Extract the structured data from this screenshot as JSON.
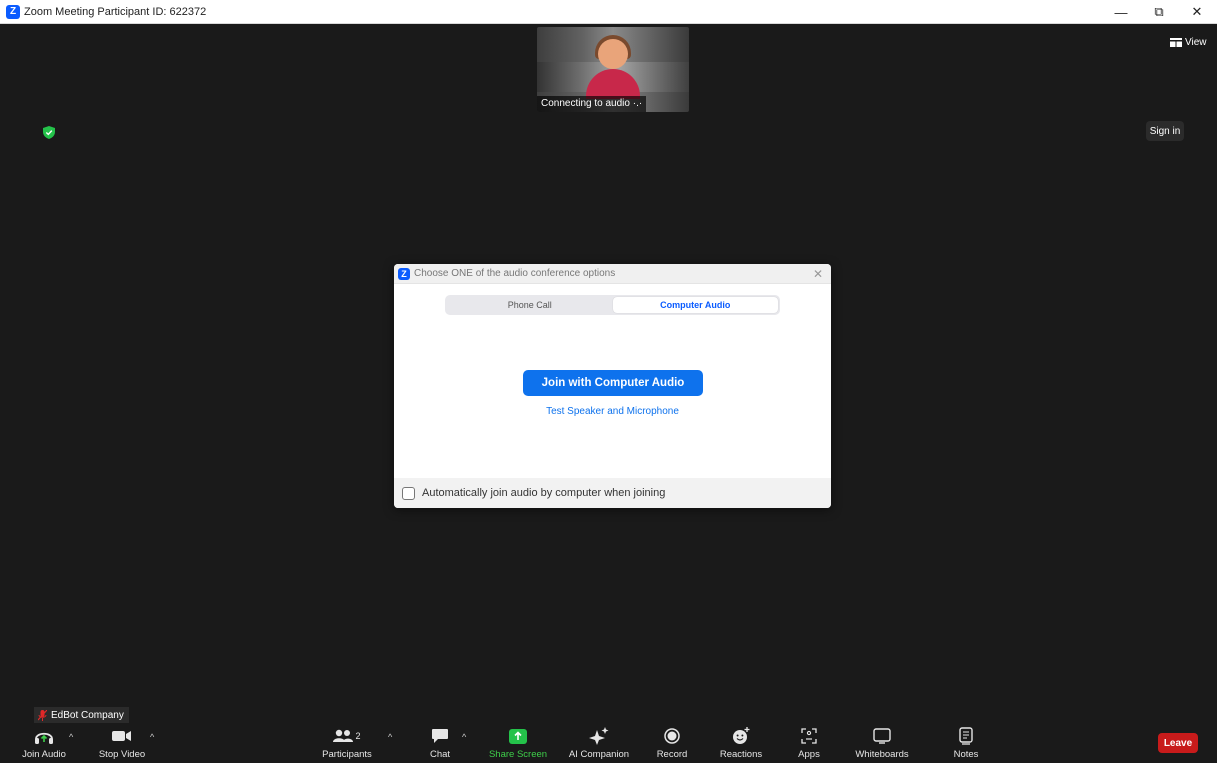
{
  "window": {
    "title": "Zoom Meeting Participant ID: 622372",
    "minimize_glyph": "—",
    "restore_glyph": "⧉",
    "close_glyph": "✕"
  },
  "stage": {
    "video_status": "Connecting to audio ·.·",
    "view_label": "View",
    "sign_in_label": "Sign in",
    "security_color": "#24c24a"
  },
  "dialog": {
    "title": "Choose ONE of the audio conference options",
    "tabs": [
      {
        "label": "Phone Call",
        "active": false
      },
      {
        "label": "Computer Audio",
        "active": true
      }
    ],
    "join_button": "Join with Computer Audio",
    "test_link": "Test Speaker and Microphone",
    "auto_join_label": "Automatically join audio by computer when joining",
    "auto_join_checked": false,
    "accent_color": "#0e72ed"
  },
  "name_tag": {
    "name": "EdBot Company",
    "muted_icon": "mic-muted-icon"
  },
  "toolbar": {
    "join_audio": "Join Audio",
    "stop_video": "Stop Video",
    "participants": "Participants",
    "participants_count": "2",
    "chat": "Chat",
    "share_screen": "Share Screen",
    "ai_companion": "AI Companion",
    "record": "Record",
    "reactions": "Reactions",
    "apps": "Apps",
    "whiteboards": "Whiteboards",
    "notes": "Notes",
    "leave": "Leave",
    "leave_color": "#c81b1b",
    "share_color": "#24c24a"
  }
}
